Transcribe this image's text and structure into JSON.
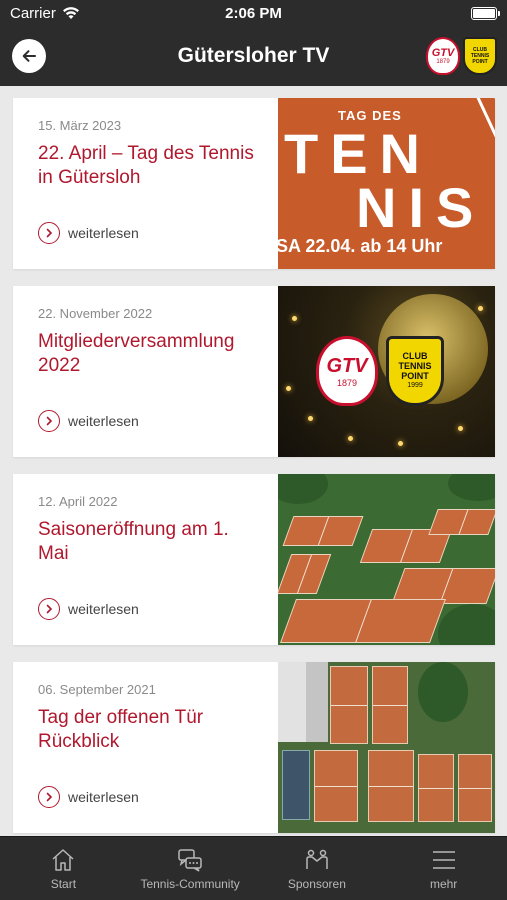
{
  "status": {
    "carrier": "Carrier",
    "time": "2:06 PM",
    "battery_level": 1.0
  },
  "nav": {
    "title": "Gütersloher TV",
    "gtv_logo_text": "GTV",
    "gtv_logo_year": "1879",
    "club_logo_text": "CLUB TENNIS POINT"
  },
  "articles": [
    {
      "date": "15. März 2023",
      "title": "22. April – Tag des Tennis in Gütersloh",
      "more": "weiterlesen",
      "image": {
        "tag": "TAG DES",
        "word1": "TEN",
        "word2": "NIS",
        "subtitle": "SA 22.04. ab 14 Uhr"
      }
    },
    {
      "date": "22. November 2022",
      "title": "Mitgliederversammlung 2022",
      "more": "weiterlesen",
      "image": {
        "gtv": "GTV",
        "gtv_year": "1879",
        "club_line1": "CLUB",
        "club_line2": "TENNIS",
        "club_line3": "POINT",
        "club_year": "1999"
      }
    },
    {
      "date": "12. April 2022",
      "title": "Saisoneröffnung am 1. Mai",
      "more": "weiterlesen"
    },
    {
      "date": "06. September 2021",
      "title": "Tag der offenen Tür Rückblick",
      "more": "weiterlesen"
    }
  ],
  "tabs": [
    {
      "label": "Start",
      "icon": "home-icon"
    },
    {
      "label": "Tennis-Community",
      "icon": "chat-icon"
    },
    {
      "label": "Sponsoren",
      "icon": "handshake-icon"
    },
    {
      "label": "mehr",
      "icon": "menu-icon"
    }
  ],
  "colors": {
    "accent": "#b0182e",
    "bar": "#2c2c2c",
    "background": "#e9e9e9"
  }
}
